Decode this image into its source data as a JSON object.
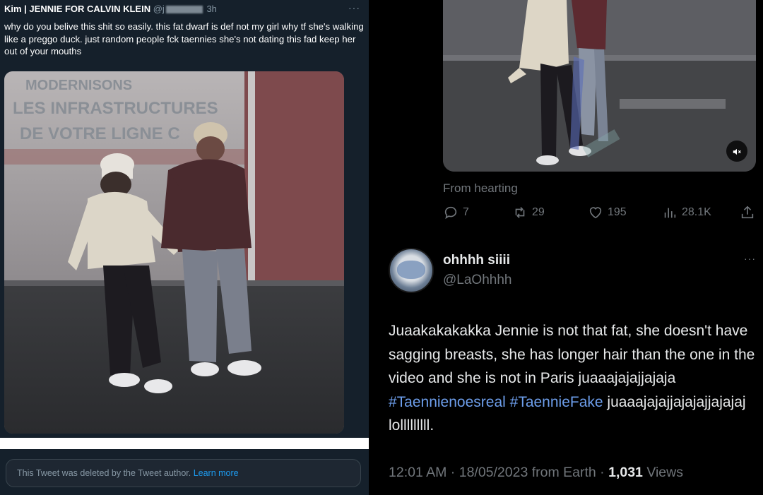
{
  "left_tweet": {
    "display_name": "Kim | JENNIE FOR CALVIN KLEIN",
    "handle_prefix": "@j",
    "time": "3h",
    "more": "···",
    "text": "why do you belive this shit so easily. this fat dwarf is def not my girl why tf she's walking like a preggo duck. just random people fck taennies she's not dating this fad keep her out of your mouths",
    "media_sign_lines": [
      "MODERNISONS",
      "LES INFRASTRUCTURES",
      "DE VOTRE LIGNE C"
    ],
    "deleted_notice": "This Tweet was deleted by the Tweet author.",
    "learn_more": "Learn more"
  },
  "right_tweet": {
    "source_line": "From hearting",
    "actions": {
      "reply_count": "7",
      "retweet_count": "29",
      "like_count": "195",
      "views_count": "28.1K"
    },
    "reply": {
      "display_name": "ohhhh siiii",
      "handle": "@LaOhhhh",
      "more": "···",
      "text_part1": "Juaakakakakka Jennie is not that fat, she doesn't have sagging breasts, she has longer hair than the one in the video and she is not in Paris juaaajajajjajaja ",
      "hashtag1": "#Taennienoesreal",
      "hashtag2": "#TaennieFake",
      "text_part2": " juaaajajajjajajajjajajaj lolllllllll.",
      "timestamp": "12:01 AM · 18/05/2023 from Earth · ",
      "views_num": "1,031",
      "views_label": " Views"
    }
  },
  "colors": {
    "left_bg": "#15202b",
    "right_bg": "#000000",
    "link_blue": "#1d9bf0",
    "hashtag_blue": "#6d9eeb",
    "muted_gray": "#71767b"
  }
}
